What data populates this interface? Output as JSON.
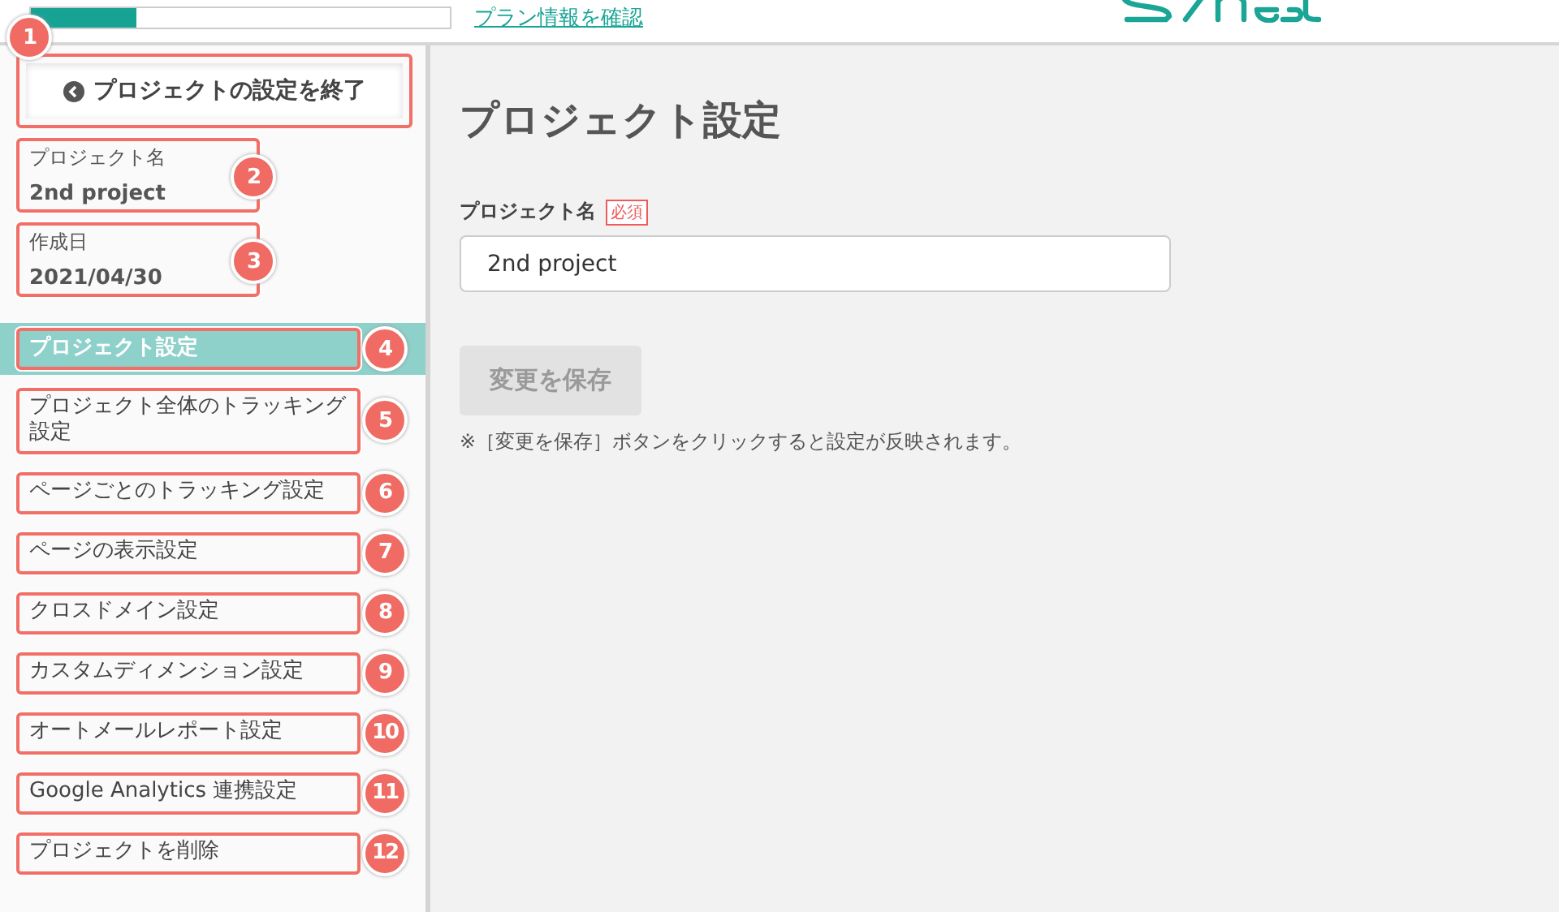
{
  "header": {
    "plan_usage": {
      "level": 0.25
    },
    "plan_link": "プラン情報を確認"
  },
  "sidebar": {
    "exit_button": {
      "label": "プロジェクトの設定を終了",
      "callout": "1"
    },
    "info": [
      {
        "label": "プロジェクト名",
        "value": "2nd project",
        "callout": "2"
      },
      {
        "label": "作成日",
        "value": "2021/04/30",
        "callout": "3"
      }
    ],
    "items": [
      {
        "label": "プロジェクト設定",
        "selected": true,
        "callout": "4"
      },
      {
        "label": "プロジェクト全体のトラッキング設定",
        "selected": false,
        "callout": "5"
      },
      {
        "label": "ページごとのトラッキング設定",
        "selected": false,
        "callout": "6"
      },
      {
        "label": "ページの表示設定",
        "selected": false,
        "callout": "7"
      },
      {
        "label": "クロスドメイン設定",
        "selected": false,
        "callout": "8"
      },
      {
        "label": "カスタムディメンション設定",
        "selected": false,
        "callout": "9"
      },
      {
        "label": "オートメールレポート設定",
        "selected": false,
        "callout": "10"
      },
      {
        "label": "Google Analytics 連携設定",
        "selected": false,
        "callout": "11"
      },
      {
        "label": "プロジェクトを削除",
        "selected": false,
        "callout": "12"
      }
    ]
  },
  "main": {
    "title": "プロジェクト設定",
    "field": {
      "label": "プロジェクト名",
      "required_badge": "必須",
      "value": "2nd project"
    },
    "save_button": {
      "label": "変更を保存",
      "disabled": true
    },
    "note": "※［変更を保存］ボタンをクリックすると設定が反映されます。"
  }
}
